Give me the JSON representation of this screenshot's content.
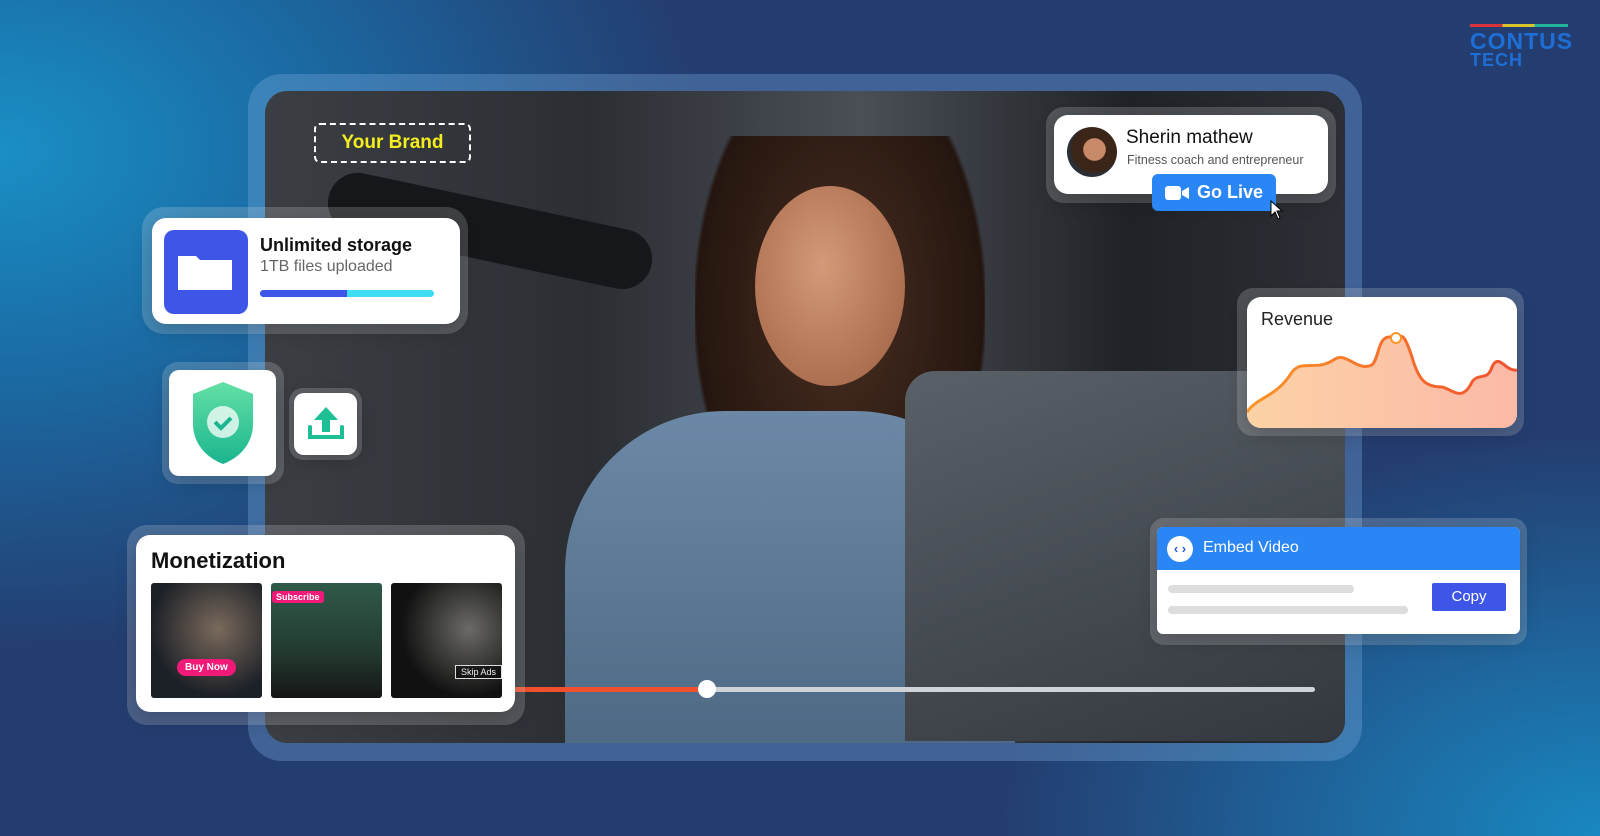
{
  "logo": {
    "line1": "CONTUS",
    "line2": "TECH"
  },
  "brand": {
    "label": "Your Brand",
    "color": "#f5ee1e"
  },
  "profile": {
    "name": "Sherin mathew",
    "subtitle": "Fitness coach and entrepreneur",
    "go_live": "Go Live",
    "icon": "video-camera-icon"
  },
  "storage": {
    "title": "Unlimited storage",
    "subtitle": "1TB files uploaded",
    "progress": 0.5,
    "icon": "folder-icon"
  },
  "security": {
    "icon": "shield-check-icon"
  },
  "upload": {
    "icon": "upload-icon"
  },
  "revenue": {
    "title": "Revenue"
  },
  "embed": {
    "title": "Embed Video",
    "copy": "Copy",
    "icon": "code-icon"
  },
  "monetization": {
    "title": "Monetization",
    "items": [
      {
        "badge": "Buy Now"
      },
      {
        "badge": "Subscribe"
      },
      {
        "badge": "Skip Ads"
      }
    ]
  },
  "player": {
    "progress": 0.41,
    "played_color": "#f0502e"
  }
}
